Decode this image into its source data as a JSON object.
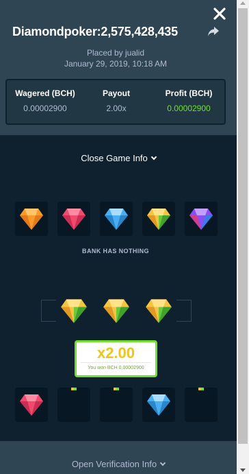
{
  "header": {
    "title": "Diamondpoker:2,575,428,435",
    "placed_by": "Placed by jualid",
    "date": "January 29, 2019, 10:18 AM",
    "close_icon": "close-icon",
    "share_icon": "share-icon"
  },
  "stats": {
    "wagered_label": "Wagered (BCH)",
    "wagered_value": "0.00002900",
    "payout_label": "Payout",
    "payout_value": "2.00x",
    "profit_label": "Profit (BCH)",
    "profit_value": "0.00002900"
  },
  "game": {
    "toggle_label": "Close Game Info",
    "bank_gems": [
      "orange",
      "pink",
      "blue",
      "yellow-green",
      "purple"
    ],
    "bank_label": "BANK HAS NOTHING",
    "player_gems": [
      "yellow-green",
      "yellow-green",
      "yellow-green"
    ],
    "result_multiplier": "x2.00",
    "result_won": "You won BCH 0.00002900",
    "dealer_gems": [
      "pink",
      "",
      "",
      "blue",
      ""
    ]
  },
  "footer": {
    "verification_label": "Open Verification Info"
  },
  "colors": {
    "accent_green": "#6fe12c",
    "gold": "#f0c419",
    "panel": "#2f4553",
    "background": "#0f212e"
  }
}
